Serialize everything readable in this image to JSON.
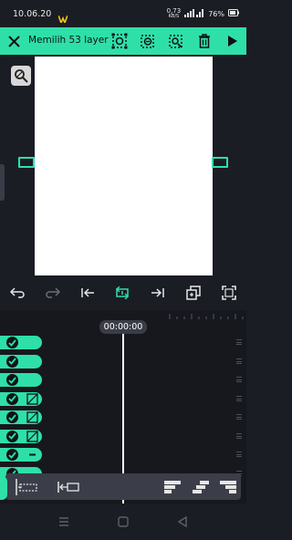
{
  "status_bar": {
    "time": "10.06.20",
    "network_speed": "0,73",
    "network_unit": "KB/S",
    "battery": "76%"
  },
  "toolbar": {
    "title": "Memilih 53 layer",
    "accent_color": "#2ee0a8"
  },
  "timeline": {
    "current_time": "00:00:00",
    "layers": [
      {
        "checked": true,
        "glyph": "none"
      },
      {
        "checked": true,
        "glyph": "none"
      },
      {
        "checked": true,
        "glyph": "none"
      },
      {
        "checked": true,
        "glyph": "shape-icon"
      },
      {
        "checked": true,
        "glyph": "shape-icon"
      },
      {
        "checked": true,
        "glyph": "shape-icon"
      },
      {
        "checked": true,
        "glyph": "line-icon"
      },
      {
        "checked": true,
        "glyph": "none"
      }
    ]
  }
}
